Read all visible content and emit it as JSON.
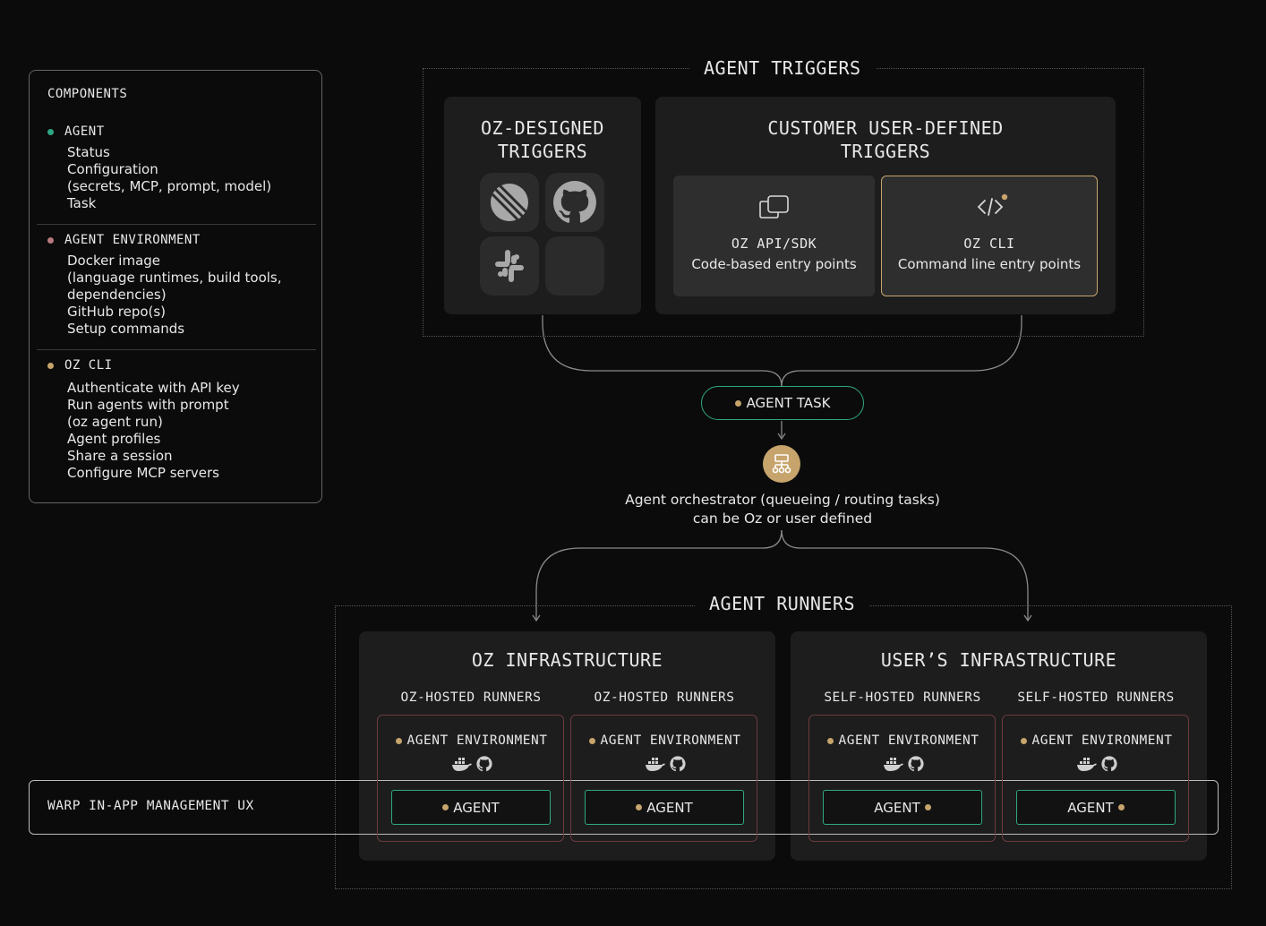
{
  "components": {
    "title": "COMPONENTS",
    "agent": {
      "title": "AGENT",
      "color": "#2fa784",
      "items": [
        "Status",
        "Configuration",
        "(secrets, MCP, prompt, model)",
        "Task"
      ]
    },
    "environment": {
      "title": "AGENT ENVIRONMENT",
      "color": "#b77a7e",
      "items": [
        "Docker image",
        "(language runtimes, build tools,",
        "dependencies)",
        "GitHub repo(s)",
        "Setup commands"
      ]
    },
    "cli": {
      "title": "OZ CLI",
      "color": "#c6a46c",
      "items": [
        "Authenticate with API key",
        "Run agents with prompt",
        "(oz agent run)",
        "Agent profiles",
        "Share a session",
        "Configure MCP servers"
      ]
    }
  },
  "triggers": {
    "title": "AGENT TRIGGERS",
    "oz_designed": {
      "line1": "OZ-DESIGNED",
      "line2": "TRIGGERS",
      "icons": [
        "linear-icon",
        "github-icon",
        "slack-icon",
        "blank-tile"
      ]
    },
    "customer": {
      "line1": "CUSTOMER USER-DEFINED",
      "line2": "TRIGGERS",
      "api": {
        "title": "OZ API/SDK",
        "subtitle": "Code-based entry points"
      },
      "cli": {
        "title": "OZ CLI",
        "subtitle": "Command line entry points"
      }
    }
  },
  "task": {
    "label": "AGENT TASK"
  },
  "orchestrator": {
    "line1": "Agent orchestrator (queueing / routing tasks)",
    "line2": "can be Oz or user defined"
  },
  "runners": {
    "title": "AGENT RUNNERS",
    "oz": {
      "title": "OZ INFRASTRUCTURE",
      "columns": [
        {
          "runner": "OZ-HOSTED RUNNERS",
          "env": "AGENT ENVIRONMENT",
          "agent": "AGENT"
        },
        {
          "runner": "OZ-HOSTED RUNNERS",
          "env": "AGENT ENVIRONMENT",
          "agent": "AGENT"
        }
      ]
    },
    "user": {
      "title": "USER’S INFRASTRUCTURE",
      "columns": [
        {
          "runner": "SELF-HOSTED RUNNERS",
          "env": "AGENT ENVIRONMENT",
          "agent": "AGENT"
        },
        {
          "runner": "SELF-HOSTED RUNNERS",
          "env": "AGENT ENVIRONMENT",
          "agent": "AGENT"
        }
      ]
    }
  },
  "warp": {
    "label": "WARP IN-APP MANAGEMENT UX"
  },
  "colors": {
    "green": "#2fa784",
    "gold": "#c6a46c",
    "rose": "#b77a7e",
    "background": "#0b0b0b"
  }
}
